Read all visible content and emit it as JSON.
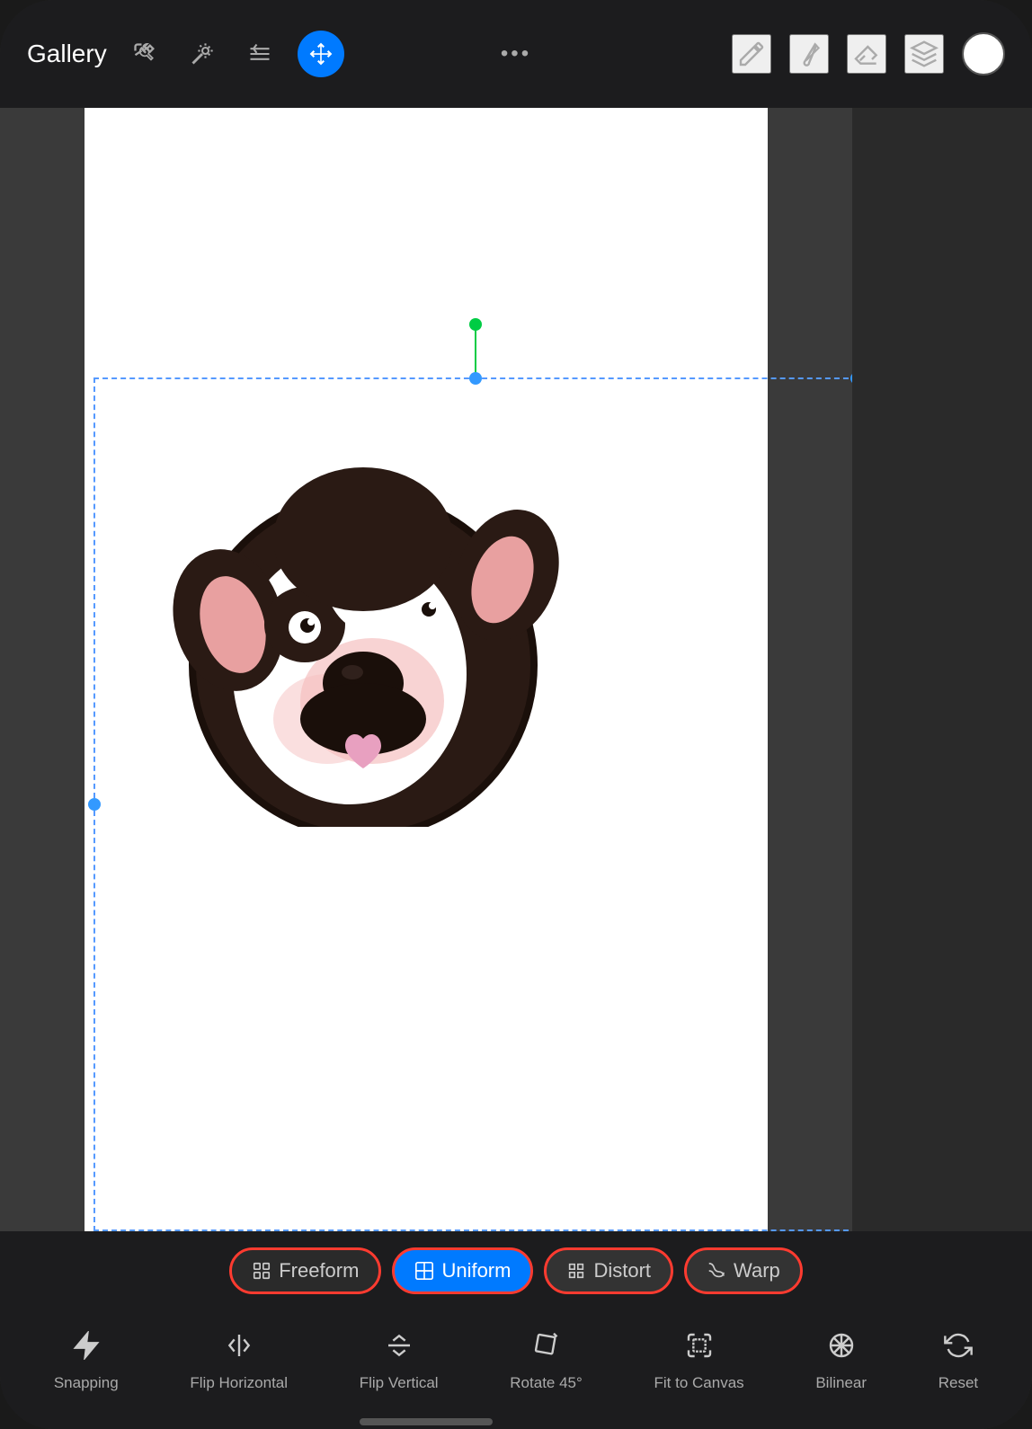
{
  "header": {
    "gallery_label": "Gallery",
    "dots_label": "•••"
  },
  "mode_tabs": [
    {
      "id": "freeform",
      "label": "Freeform",
      "state": "outlined-red",
      "icon": "⊞"
    },
    {
      "id": "uniform",
      "label": "Uniform",
      "state": "active-blue",
      "icon": "⊟"
    },
    {
      "id": "distort",
      "label": "Distort",
      "state": "outlined-red-dark",
      "icon": "⊡"
    },
    {
      "id": "warp",
      "label": "Warp",
      "state": "outlined-red-dark",
      "icon": "◱"
    }
  ],
  "action_buttons": [
    {
      "id": "snapping",
      "label": "Snapping",
      "icon": "⚡"
    },
    {
      "id": "flip-horizontal",
      "label": "Flip Horizontal",
      "icon": "⇔"
    },
    {
      "id": "flip-vertical",
      "label": "Flip Vertical",
      "icon": "⇕"
    },
    {
      "id": "rotate45",
      "label": "Rotate 45°",
      "icon": "↻"
    },
    {
      "id": "fit-canvas",
      "label": "Fit to Canvas",
      "icon": "⤢"
    },
    {
      "id": "bilinear",
      "label": "Bilinear",
      "icon": "⊞"
    },
    {
      "id": "reset",
      "label": "Reset",
      "icon": "↺"
    }
  ],
  "colors": {
    "active_blue": "#007AFF",
    "red_border": "#ff3b30",
    "green_handle": "#00cc44",
    "selection_blue": "#3399ff"
  }
}
